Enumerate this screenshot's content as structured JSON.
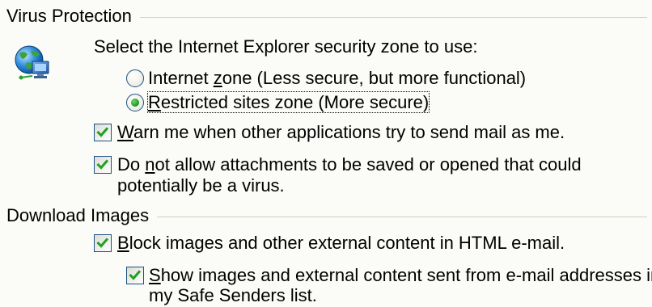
{
  "virus_protection": {
    "heading": "Virus Protection",
    "zone_prompt": "Select the Internet Explorer security zone to use:",
    "internet_zone": {
      "pre": "Internet ",
      "accel": "z",
      "post": "one (Less secure, but more functional)",
      "selected": false
    },
    "restricted_zone": {
      "pre": "",
      "accel": "R",
      "post": "estricted sites zone (More secure)",
      "selected": true
    },
    "warn_mail": {
      "pre": "",
      "accel": "W",
      "post": "arn me when other applications try to send mail as me.",
      "checked": true
    },
    "block_attachments": {
      "line1_pre": "Do ",
      "line1_accel": "n",
      "line1_post": "ot allow attachments to be saved or opened that could",
      "line2": "potentially be a virus.",
      "checked": true
    }
  },
  "download_images": {
    "heading": "Download Images",
    "block_images": {
      "pre": "",
      "accel": "B",
      "post": "lock images and other external content in HTML e-mail.",
      "checked": true
    },
    "show_safe_senders": {
      "line1_pre": "",
      "line1_accel": "S",
      "line1_post": "how images and external content sent from e-mail addresses in",
      "line2": "my Safe Senders list.",
      "checked": true
    }
  },
  "colors": {
    "control_border": "#1C5180",
    "check_green": "#21A121",
    "separator": "#D0D0BF",
    "background": "#FBFBF8"
  },
  "icons": {
    "security_zone": "globe-computer-icon"
  }
}
